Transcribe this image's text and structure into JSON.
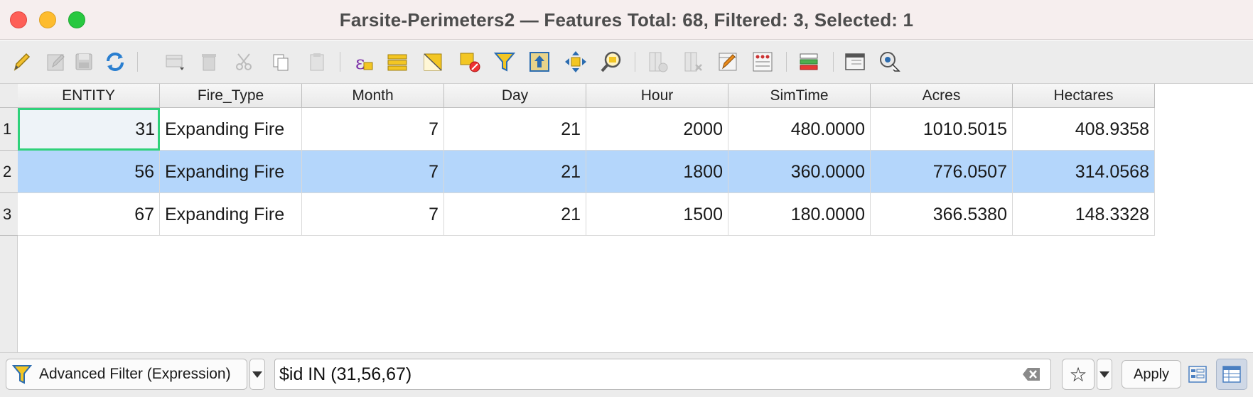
{
  "window": {
    "title": "Farsite-Perimeters2 — Features Total: 68, Filtered: 3, Selected: 1"
  },
  "toolbar": {
    "buttons": [
      "toggle-editing",
      "toggle-multi-edit",
      "save-edits",
      "reload-table",
      "add-feature",
      "delete-selected",
      "cut-selected",
      "copy-selected",
      "paste-features",
      "select-by-expression",
      "select-all",
      "invert-selection",
      "deselect-all",
      "filter-select",
      "move-selection-to-top",
      "pan-to-selected",
      "zoom-to-selected",
      "new-field",
      "delete-field",
      "organize-columns",
      "field-calculator",
      "conditional-formatting",
      "dock-attribute-table",
      "actions"
    ]
  },
  "table": {
    "columns": [
      "ENTITY",
      "Fire_Type",
      "Month",
      "Day",
      "Hour",
      "SimTime",
      "Acres",
      "Hectares"
    ],
    "row_numbers": [
      "1",
      "2",
      "3"
    ],
    "rows": [
      [
        "31",
        "Expanding Fire",
        "7",
        "21",
        "2000",
        "480.0000",
        "1010.5015",
        "408.9358"
      ],
      [
        "56",
        "Expanding Fire",
        "7",
        "21",
        "1800",
        "360.0000",
        "776.0507",
        "314.0568"
      ],
      [
        "67",
        "Expanding Fire",
        "7",
        "21",
        "1500",
        "180.0000",
        "366.5380",
        "148.3328"
      ]
    ],
    "selected_row": 2,
    "current_cell": "1-1"
  },
  "filter_bar": {
    "filter_mode": "Advanced Filter (Expression)",
    "expression": "$id IN (31,56,67)",
    "apply_label": "Apply"
  },
  "colors": {
    "selection": "#b4d6fb",
    "current_cell_border": "#2fd17a",
    "close": "#fe5f57",
    "minimize": "#febc2e",
    "maximize": "#28c840"
  }
}
